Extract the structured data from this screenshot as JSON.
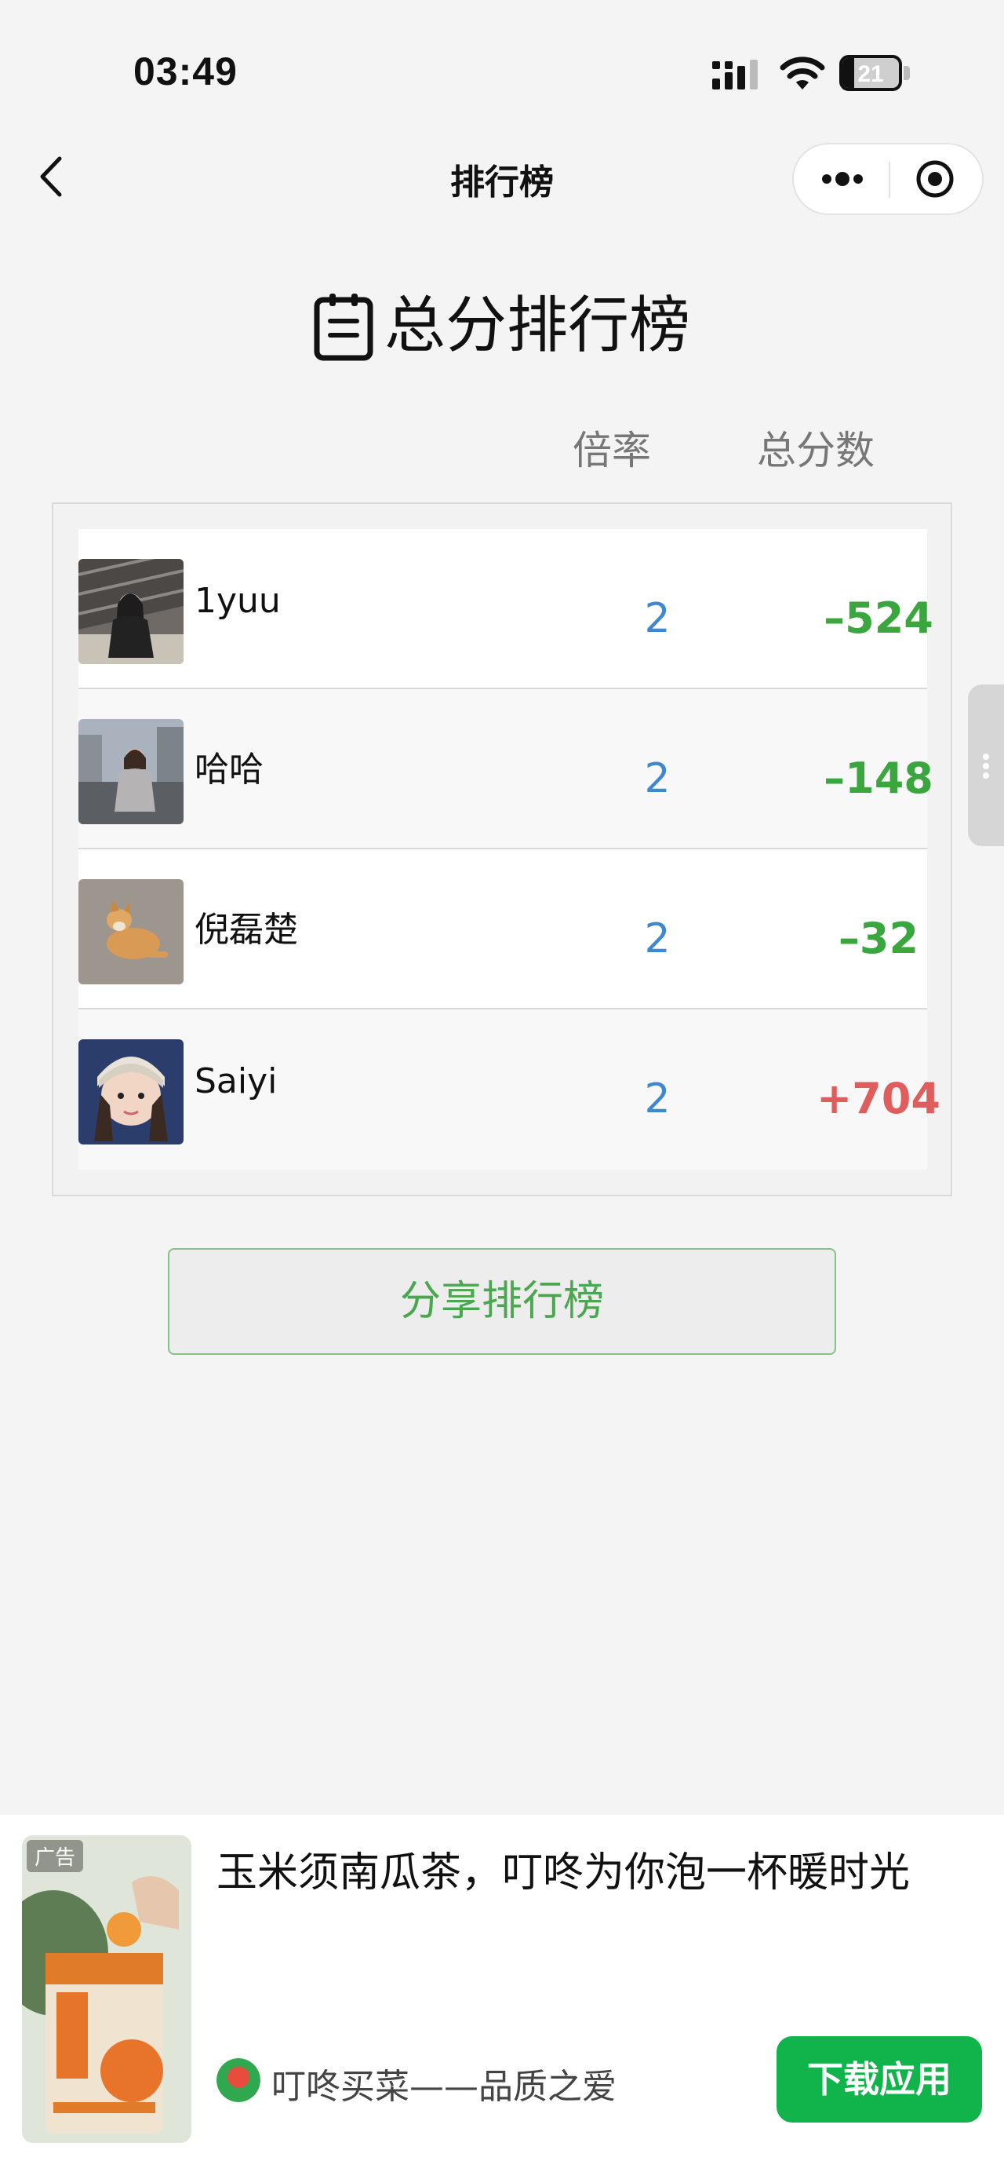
{
  "status_bar": {
    "time": "03:49",
    "battery": "21"
  },
  "nav": {
    "title": "排行榜"
  },
  "header": {
    "title": "总分排行榜",
    "col_rate": "倍率",
    "col_total": "总分数"
  },
  "leaderboard": [
    {
      "name": "1yuu",
      "rate": "2",
      "score": "–524"
    },
    {
      "name": "哈哈",
      "rate": "2",
      "score": "–148"
    },
    {
      "name": "倪磊楚",
      "rate": "2",
      "score": "–32"
    },
    {
      "name": "Saiyi",
      "rate": "2",
      "score": "+704"
    }
  ],
  "share_button": "分享排行榜",
  "ad": {
    "tag": "广告",
    "title": "玉米须南瓜茶，叮咚为你泡一杯暖时光",
    "brand": "叮咚买菜——品质之爱",
    "cta": "下载应用"
  },
  "colors": {
    "negative": "#3aa63e",
    "positive": "#e05d5d",
    "rate": "#3f87d0",
    "accent": "#10b44a"
  }
}
